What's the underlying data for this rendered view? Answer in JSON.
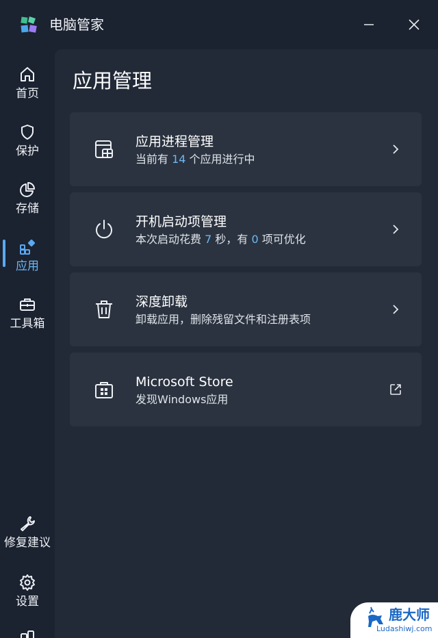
{
  "window": {
    "title": "电脑管家",
    "minimize_icon": "minimize-icon",
    "close_icon": "close-icon"
  },
  "sidebar": {
    "items": [
      {
        "label": "首页",
        "icon": "home-icon"
      },
      {
        "label": "保护",
        "icon": "shield-icon"
      },
      {
        "label": "存储",
        "icon": "pie-chart-icon"
      },
      {
        "label": "应用",
        "icon": "apps-icon",
        "active": true
      },
      {
        "label": "工具箱",
        "icon": "toolbox-icon"
      }
    ],
    "bottom_items": [
      {
        "label": "修复建议",
        "icon": "wrench-icon"
      },
      {
        "label": "设置",
        "icon": "gear-icon"
      }
    ]
  },
  "main": {
    "title": "应用管理",
    "cards": [
      {
        "title": "应用进程管理",
        "sub_prefix": "当前有 ",
        "sub_num": "14",
        "sub_suffix": " 个应用进行中",
        "icon": "app-process-icon",
        "action_icon": "chevron-right-icon"
      },
      {
        "title": "开机启动项管理",
        "sub_prefix": "本次启动花费 ",
        "sub_num": "7",
        "sub_mid": " 秒，有 ",
        "sub_num2": "0",
        "sub_suffix": " 项可优化",
        "icon": "power-icon",
        "action_icon": "chevron-right-icon"
      },
      {
        "title": "深度卸载",
        "sub_prefix": "卸载应用，删除残留文件和注册表项",
        "icon": "trash-icon",
        "action_icon": "chevron-right-icon"
      },
      {
        "title": "Microsoft Store",
        "sub_prefix": "发现Windows应用",
        "icon": "store-icon",
        "action_icon": "external-link-icon"
      }
    ]
  },
  "watermark": {
    "name": "鹿大师",
    "url": "Ludashiwj.com"
  },
  "colors": {
    "background": "#1b2230",
    "content": "#222a38",
    "card": "#2b3340",
    "accent": "#5aa9f2",
    "number": "#6cb8f5"
  }
}
